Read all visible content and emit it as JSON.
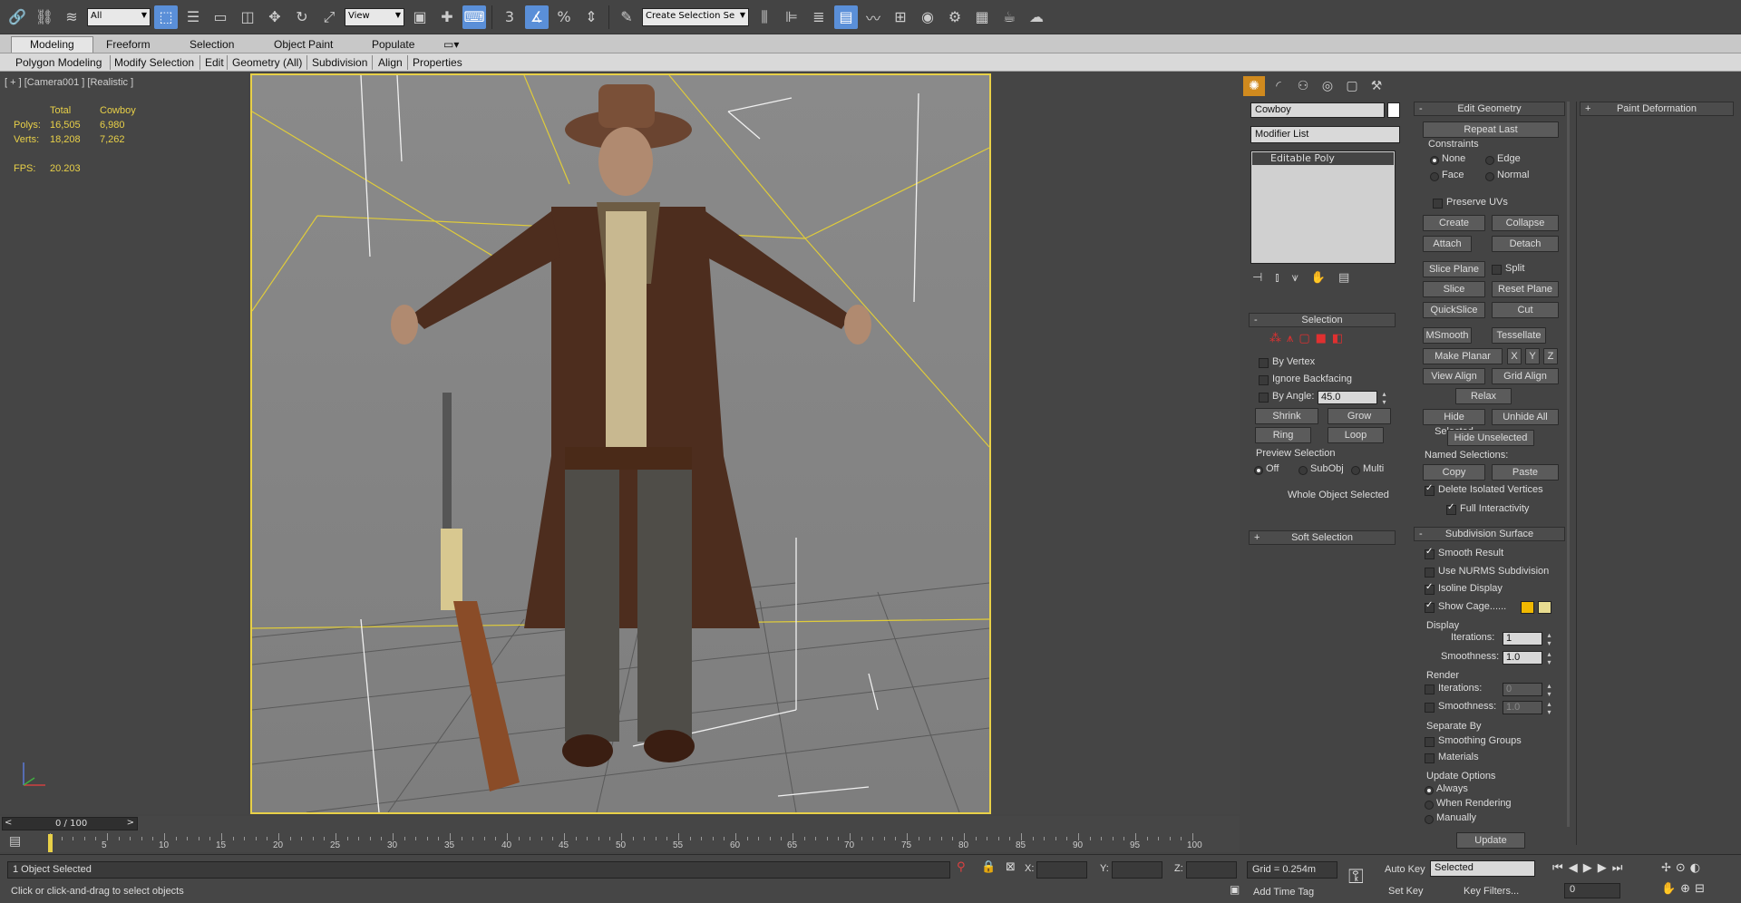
{
  "toolbar": {
    "filter_value": "All",
    "refcoord_value": "View",
    "selection_set_placeholder": "Create Selection Se",
    "snap_label": "3"
  },
  "ribbon": {
    "tabs": [
      "Modeling",
      "Freeform",
      "Selection",
      "Object Paint",
      "Populate"
    ],
    "panels": [
      "Polygon Modeling",
      "Modify Selection",
      "Edit",
      "Geometry (All)",
      "Subdivision",
      "Align",
      "Properties"
    ]
  },
  "viewport": {
    "label": "[ + ] [Camera001 ] [Realistic ]",
    "stats": {
      "col_total": "Total",
      "col_obj": "Cowboy",
      "polys_label": "Polys:",
      "polys_total": "16,505",
      "polys_obj": "6,980",
      "verts_label": "Verts:",
      "verts_total": "18,208",
      "verts_obj": "7,262",
      "fps_label": "FPS:",
      "fps_value": "20.203"
    }
  },
  "timeline": {
    "frame": "0 / 100",
    "ticks": [
      "5",
      "10",
      "15",
      "20",
      "25",
      "30",
      "35",
      "40",
      "45",
      "50",
      "55",
      "60",
      "65",
      "70",
      "75",
      "80",
      "85",
      "90",
      "95",
      "100"
    ]
  },
  "status": {
    "selected": "1 Object Selected",
    "prompt": "Click or click-and-drag to select objects",
    "x_label": "X:",
    "y_label": "Y:",
    "z_label": "Z:",
    "grid": "Grid = 0.254m",
    "add_time_tag": "Add Time Tag",
    "auto_key": "Auto Key",
    "set_key": "Set Key",
    "key_mode": "Selected",
    "key_filters": "Key Filters...",
    "frame_value": "0"
  },
  "command": {
    "object_name": "Cowboy",
    "modifier_list": "Modifier List",
    "stack_item": "Editable Poly",
    "selection": {
      "title": "Selection",
      "by_vertex": "By Vertex",
      "ignore_backfacing": "Ignore Backfacing",
      "by_angle": "By Angle:",
      "angle_value": "45.0",
      "shrink": "Shrink",
      "grow": "Grow",
      "ring": "Ring",
      "loop": "Loop",
      "preview": "Preview Selection",
      "off": "Off",
      "subobj": "SubObj",
      "multi": "Multi",
      "whole": "Whole Object Selected"
    },
    "soft_selection": "Soft Selection"
  },
  "edit_geometry": {
    "title": "Edit Geometry",
    "repeat_last": "Repeat Last",
    "constraints": "Constraints",
    "none": "None",
    "edge": "Edge",
    "face": "Face",
    "normal": "Normal",
    "preserve_uvs": "Preserve UVs",
    "create": "Create",
    "collapse": "Collapse",
    "attach": "Attach",
    "detach": "Detach",
    "slice_plane": "Slice Plane",
    "split": "Split",
    "slice": "Slice",
    "reset_plane": "Reset Plane",
    "quickslice": "QuickSlice",
    "cut": "Cut",
    "msmooth": "MSmooth",
    "tessellate": "Tessellate",
    "make_planar": "Make Planar",
    "x": "X",
    "y": "Y",
    "z": "Z",
    "view_align": "View Align",
    "grid_align": "Grid Align",
    "relax": "Relax",
    "hide_selected": "Hide Selected",
    "unhide_all": "Unhide All",
    "hide_unselected": "Hide Unselected",
    "named_sel": "Named Selections:",
    "copy": "Copy",
    "paste": "Paste",
    "delete_isolated": "Delete Isolated Vertices",
    "full_interactivity": "Full Interactivity"
  },
  "subdivision": {
    "title": "Subdivision Surface",
    "smooth_result": "Smooth Result",
    "use_nurms": "Use NURMS Subdivision",
    "isoline": "Isoline Display",
    "show_cage": "Show Cage......",
    "display": "Display",
    "iterations": "Iterations:",
    "iter_value": "1",
    "smoothness": "Smoothness:",
    "smooth_value": "1.0",
    "render": "Render",
    "r_iter_value": "0",
    "r_smooth_value": "1.0",
    "separate_by": "Separate By",
    "smoothing_groups": "Smoothing Groups",
    "materials": "Materials",
    "update_options": "Update Options",
    "always": "Always",
    "when_rendering": "When Rendering",
    "manually": "Manually",
    "update": "Update"
  },
  "paint_deformation": "Paint Deformation"
}
